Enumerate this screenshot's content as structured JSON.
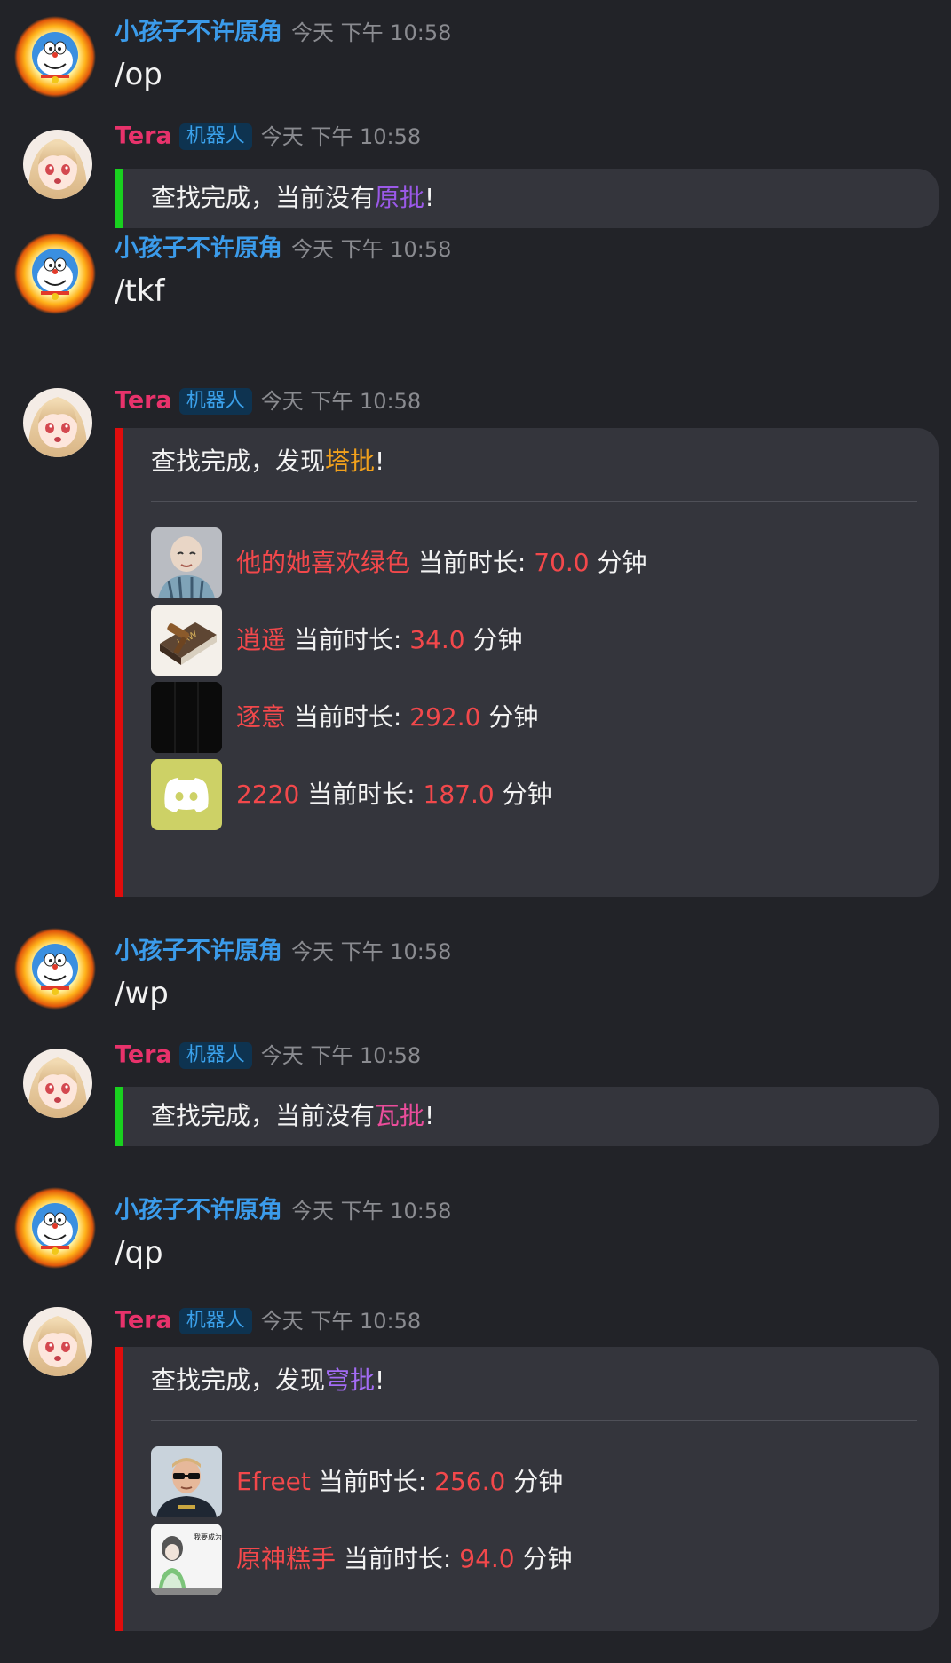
{
  "messages": [
    {
      "author": "小孩子不许原角",
      "time": "今天 下午 10:58",
      "command": "/op"
    },
    {
      "author": "Tera",
      "tag": "机器人",
      "time": "今天 下午 10:58",
      "text_prefix": "查找完成，当前没有",
      "text_highlight": "原批",
      "text_suffix": "!"
    },
    {
      "author": "小孩子不许原角",
      "time": "今天 下午 10:58",
      "command": "/tkf"
    },
    {
      "author": "Tera",
      "tag": "机器人",
      "time": "今天 下午 10:58",
      "text_prefix": "查找完成，发现",
      "text_highlight": "塔批",
      "text_suffix": "!",
      "rows": [
        {
          "name": "他的她喜欢绿色",
          "label": "当前时长:",
          "value": "70.0",
          "unit": "分钟"
        },
        {
          "name": "逍遥",
          "label": "当前时长:",
          "value": "34.0",
          "unit": "分钟"
        },
        {
          "name": "逐意",
          "label": "当前时长:",
          "value": "292.0",
          "unit": "分钟"
        },
        {
          "name": "2220",
          "label": "当前时长:",
          "value": "187.0",
          "unit": "分钟"
        }
      ]
    },
    {
      "author": "小孩子不许原角",
      "time": "今天 下午 10:58",
      "command": "/wp"
    },
    {
      "author": "Tera",
      "tag": "机器人",
      "time": "今天 下午 10:58",
      "text_prefix": "查找完成，当前没有",
      "text_highlight": "瓦批",
      "text_suffix": "!"
    },
    {
      "author": "小孩子不许原角",
      "time": "今天 下午 10:58",
      "command": "/qp"
    },
    {
      "author": "Tera",
      "tag": "机器人",
      "time": "今天 下午 10:58",
      "text_prefix": "查找完成，发现",
      "text_highlight": "穹批",
      "text_suffix": "!",
      "rows": [
        {
          "name": "Efreet",
          "label": "当前时长:",
          "value": "256.0",
          "unit": "分钟"
        },
        {
          "name": "原神糕手",
          "label": "当前时长:",
          "value": "94.0",
          "unit": "分钟"
        }
      ]
    }
  ],
  "thumbnail_texts": {
    "law_book": "LAW",
    "sticker": "我要成为原神高手"
  },
  "colors": {
    "background": "#222328",
    "embed": "#34353c",
    "accent_green": "#19d11f",
    "accent_red": "#e00d0d",
    "user_name": "#3b9bea",
    "bot_name": "#e8326b",
    "value_red": "#f2484b"
  }
}
